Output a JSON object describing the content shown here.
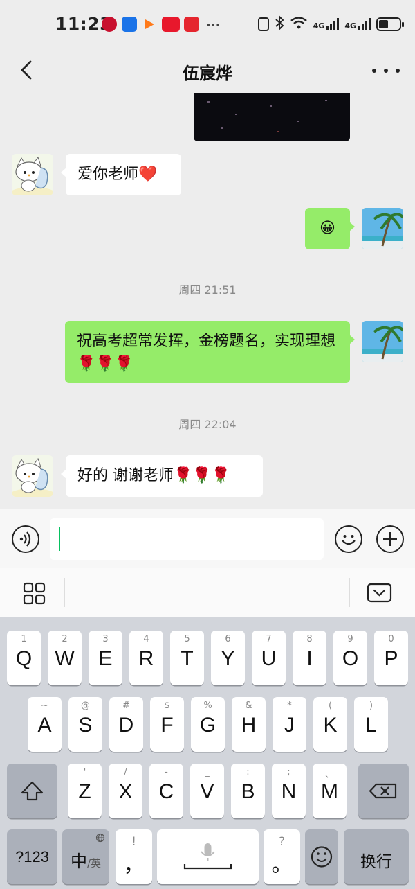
{
  "status_bar": {
    "time": "11:23",
    "network_1": "4G",
    "network_2": "4G"
  },
  "nav": {
    "title": "伍宸烨"
  },
  "messages": [
    {
      "from": "contact",
      "text": "爱你老师❤️"
    },
    {
      "from": "me",
      "text": "😀"
    },
    {
      "timestamp": "周四 21:51"
    },
    {
      "from": "me",
      "text": "祝高考超常发挥，金榜题名，实现理想🌹🌹🌹"
    },
    {
      "timestamp": "周四 22:04"
    },
    {
      "from": "contact",
      "text": "好的 谢谢老师🌹🌹🌹"
    }
  ],
  "input": {
    "value": ""
  },
  "keyboard": {
    "row1": [
      {
        "sup": "1",
        "key": "Q"
      },
      {
        "sup": "2",
        "key": "W"
      },
      {
        "sup": "3",
        "key": "E"
      },
      {
        "sup": "4",
        "key": "R"
      },
      {
        "sup": "5",
        "key": "T"
      },
      {
        "sup": "6",
        "key": "Y"
      },
      {
        "sup": "7",
        "key": "U"
      },
      {
        "sup": "8",
        "key": "I"
      },
      {
        "sup": "9",
        "key": "O"
      },
      {
        "sup": "0",
        "key": "P"
      }
    ],
    "row2": [
      {
        "sup": "~",
        "key": "A"
      },
      {
        "sup": "@",
        "key": "S"
      },
      {
        "sup": "#",
        "key": "D"
      },
      {
        "sup": "$",
        "key": "F"
      },
      {
        "sup": "%",
        "key": "G"
      },
      {
        "sup": "&",
        "key": "H"
      },
      {
        "sup": "*",
        "key": "J"
      },
      {
        "sup": "(",
        "key": "K"
      },
      {
        "sup": ")",
        "key": "L"
      }
    ],
    "row3": [
      {
        "sup": "'",
        "key": "Z"
      },
      {
        "sup": "/",
        "key": "X"
      },
      {
        "sup": "-",
        "key": "C"
      },
      {
        "sup": "_",
        "key": "V"
      },
      {
        "sup": ":",
        "key": "B"
      },
      {
        "sup": ";",
        "key": "N"
      },
      {
        "sup": "、",
        "key": "M"
      }
    ],
    "symbols_key": "?123",
    "lang_main": "中",
    "lang_alt": "/英",
    "comma_sup": "!",
    "comma_key": "，",
    "period_sup": "?",
    "period_key": "。",
    "enter_key": "换行"
  },
  "colors": {
    "bubble_out": "#95ec69",
    "bubble_in": "#ffffff",
    "background": "#ededed",
    "caret": "#07c160"
  }
}
